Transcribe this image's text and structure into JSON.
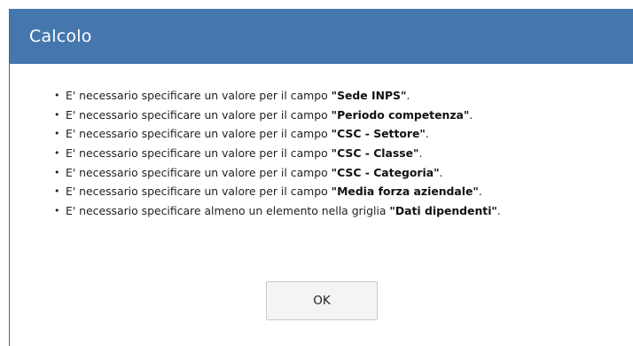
{
  "dialog": {
    "title": "Calcolo",
    "messages": [
      {
        "prefix": "E' necessario specificare un valore per il campo ",
        "field": "\"Sede INPS\"",
        "suffix": "."
      },
      {
        "prefix": "E' necessario specificare un valore per il campo ",
        "field": "\"Periodo competenza\"",
        "suffix": "."
      },
      {
        "prefix": "E' necessario specificare un valore per il campo ",
        "field": "\"CSC - Settore\"",
        "suffix": "."
      },
      {
        "prefix": "E' necessario specificare un valore per il campo ",
        "field": "\"CSC - Classe\"",
        "suffix": "."
      },
      {
        "prefix": "E' necessario specificare un valore per il campo ",
        "field": "\"CSC - Categoria\"",
        "suffix": "."
      },
      {
        "prefix": "E' necessario specificare un valore per il campo ",
        "field": "\"Media forza aziendale\"",
        "suffix": "."
      },
      {
        "prefix": "E' necessario specificare almeno un elemento nella griglia ",
        "field": "\"Dati dipendenti\"",
        "suffix": "."
      }
    ],
    "ok_label": "OK"
  },
  "colors": {
    "title_bar": "#4577ae",
    "title_text": "#ffffff",
    "button_bg": "#f4f4f4"
  }
}
